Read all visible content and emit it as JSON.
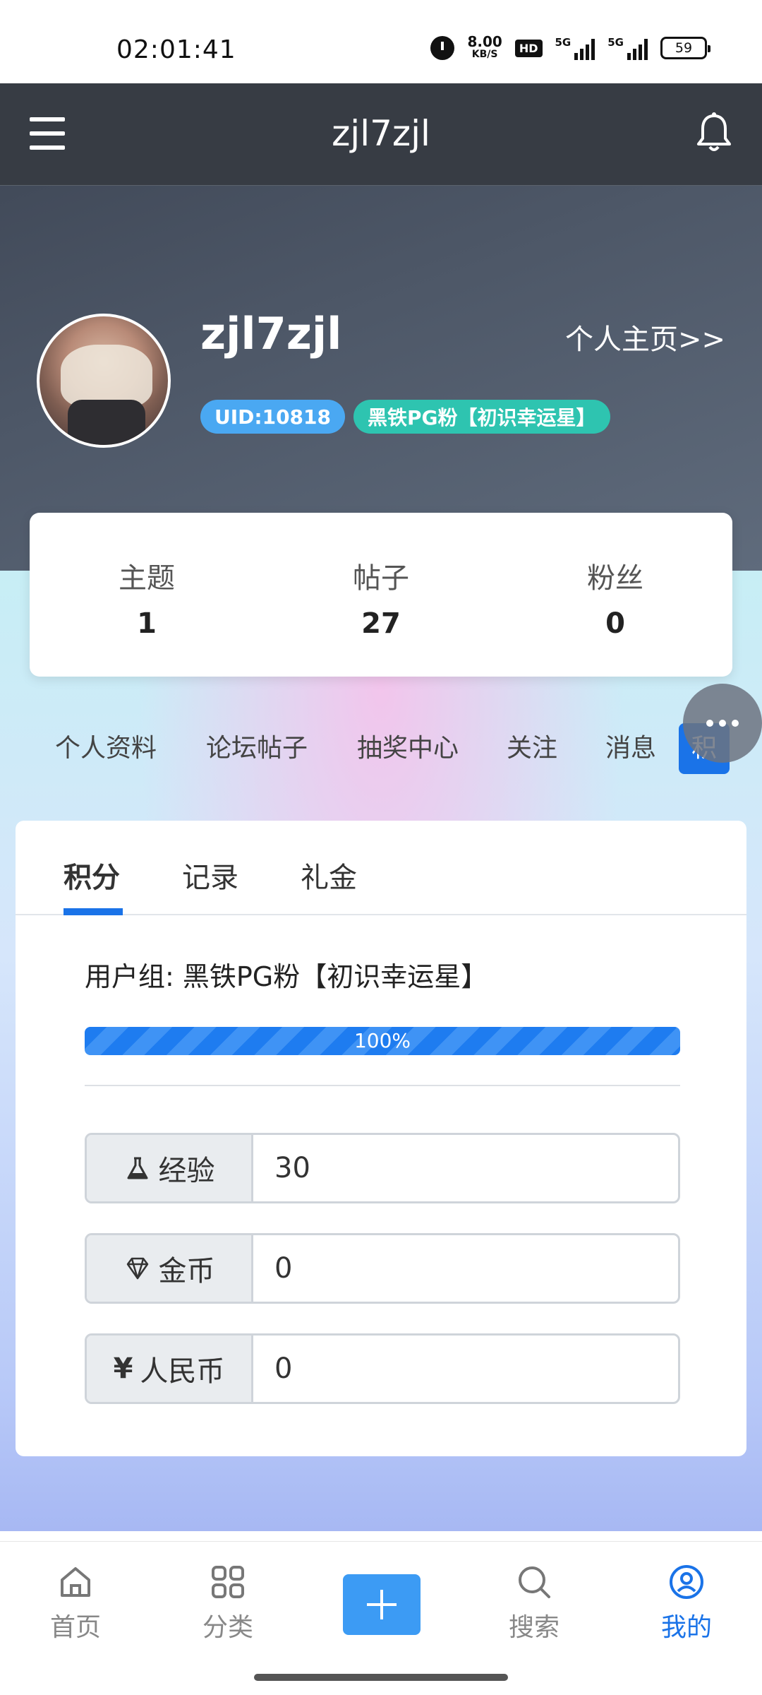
{
  "status_bar": {
    "time": "02:01:41",
    "speed_value": "8.00",
    "speed_unit": "KB/S",
    "hd_label": "HD",
    "signal1_label": "5G",
    "signal2_label": "5G",
    "battery": "59"
  },
  "header": {
    "title": "zjl7zjl"
  },
  "profile": {
    "username": "zjl7zjl",
    "home_link": "个人主页>>",
    "uid_badge": "UID:10818",
    "group_badge": "黑铁PG粉【初识幸运星】"
  },
  "stats": [
    {
      "label": "主题",
      "value": "1"
    },
    {
      "label": "帖子",
      "value": "27"
    },
    {
      "label": "粉丝",
      "value": "0"
    }
  ],
  "nav_tabs": [
    "个人资料",
    "论坛帖子",
    "抽奖中心",
    "关注",
    "消息",
    "积"
  ],
  "sub_tabs": [
    "积分",
    "记录",
    "礼金"
  ],
  "points": {
    "group_line": "用户组: 黑铁PG粉【初识幸运星】",
    "progress_percent": 100,
    "progress_label": "100%",
    "fields": [
      {
        "icon": "flask-icon",
        "label": "经验",
        "value": "30"
      },
      {
        "icon": "diamond-icon",
        "label": "金币",
        "value": "0"
      },
      {
        "icon": "yen-icon",
        "label": "人民币",
        "value": "0"
      }
    ]
  },
  "bottom_nav": [
    {
      "icon": "home-icon",
      "label": "首页"
    },
    {
      "icon": "grid-icon",
      "label": "分类"
    },
    {
      "icon": "plus-icon",
      "label": ""
    },
    {
      "icon": "search-icon",
      "label": "搜索"
    },
    {
      "icon": "user-circle-icon",
      "label": "我的"
    }
  ],
  "colors": {
    "accent": "#1a73e8",
    "uid_badge": "#4aa8f2",
    "group_badge": "#2ec4b0",
    "topbar": "#373c44"
  }
}
